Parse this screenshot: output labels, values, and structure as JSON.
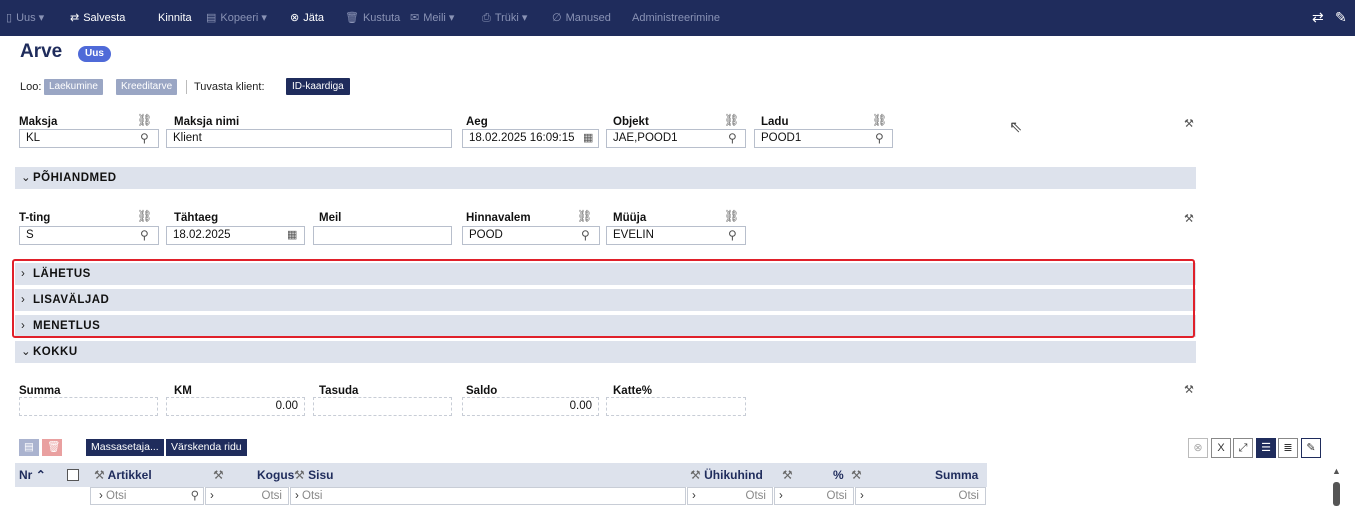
{
  "toolbar": {
    "new_label": "Uus",
    "save_label": "Salvesta",
    "confirm_label": "Kinnita",
    "copy_label": "Kopeeri",
    "leave_label": "Jäta",
    "delete_label": "Kustuta",
    "mail_label": "Meili",
    "print_label": "Trüki",
    "attachments_label": "Manused",
    "admin_label": "Administreerimine"
  },
  "header": {
    "title": "Arve",
    "badge": "Uus",
    "loo_label": "Loo:",
    "loo_btn1": "Laekumine",
    "loo_btn2": "Kreeditarve",
    "verify_label": "Tuvasta klient:",
    "verify_btn": "ID-kaardiga"
  },
  "fields1": {
    "payer_label": "Maksja",
    "payer_value": "KL",
    "payer_name_label": "Maksja nimi",
    "payer_name_value": "Klient",
    "time_label": "Aeg",
    "time_value": "18.02.2025 16:09:15",
    "object_label": "Objekt",
    "object_value": "JAE,POOD1",
    "warehouse_label": "Ladu",
    "warehouse_value": "POOD1"
  },
  "sections": {
    "main": "PÕHIANDMED",
    "shipping": "LÄHETUS",
    "extra": "LISAVÄLJAD",
    "procedure": "MENETLUS",
    "total": "KOKKU"
  },
  "fields2": {
    "terms_label": "T-ting",
    "terms_value": "S",
    "due_label": "Tähtaeg",
    "due_value": "18.02.2025",
    "email_label": "Meil",
    "email_value": "",
    "pricelist_label": "Hinnavalem",
    "pricelist_value": "POOD",
    "seller_label": "Müüja",
    "seller_value": "EVELIN"
  },
  "totals": {
    "sum_label": "Summa",
    "sum_value": "",
    "vat_label": "KM",
    "vat_value": "0.00",
    "pay_label": "Tasuda",
    "pay_value": "",
    "balance_label": "Saldo",
    "balance_value": "0.00",
    "margin_label": "Katte%",
    "margin_value": ""
  },
  "grid": {
    "mass_btn": "Massasetaja...",
    "refresh_btn": "Värskenda ridu",
    "columns": [
      "Nr",
      "Artikkel",
      "Kogus",
      "Sisu",
      "Ühikuhind",
      "%",
      "Summa"
    ],
    "search_placeholder": "Otsi"
  },
  "colors": {
    "toolbar_bg": "#1f2c5c",
    "section_bg": "#dde2ec",
    "highlight_border": "#e0202a",
    "badge": "#4f6ad8"
  }
}
